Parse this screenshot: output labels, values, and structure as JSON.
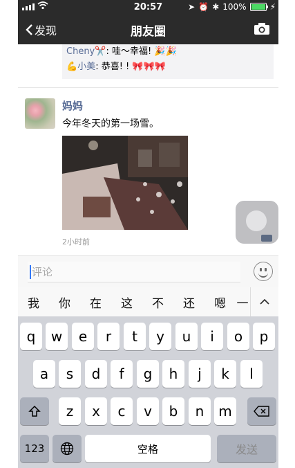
{
  "status": {
    "time": "20:57",
    "battery": "100%"
  },
  "nav": {
    "back_label": "发现",
    "title": "朋友圈"
  },
  "comments_top": [
    {
      "name": "Cheny",
      "emoji": "✂️",
      "text": ": 哇～幸福! ",
      "trail": "🎉🎉"
    },
    {
      "name": "小美",
      "emoji": "💪",
      "text": ": 恭喜! ! ",
      "trail": "🎀🎀🎀"
    }
  ],
  "post": {
    "author": "妈妈",
    "text": "今年冬天的第一场雪。",
    "time": "2小时前"
  },
  "input": {
    "placeholder": "评论"
  },
  "suggestions": [
    "我",
    "你",
    "在",
    "这",
    "不",
    "还",
    "嗯",
    "一"
  ],
  "keyboard": {
    "row1": [
      "q",
      "w",
      "e",
      "r",
      "t",
      "y",
      "u",
      "i",
      "o",
      "p"
    ],
    "row2": [
      "a",
      "s",
      "d",
      "f",
      "g",
      "h",
      "j",
      "k",
      "l"
    ],
    "row3": [
      "z",
      "x",
      "c",
      "v",
      "b",
      "n",
      "m"
    ],
    "numbers": "123",
    "space": "空格",
    "send": "发送"
  },
  "icons": {
    "back": "chevron-left-icon",
    "camera": "camera-icon",
    "emoji": "smiley-icon",
    "shift": "shift-icon",
    "delete": "backspace-icon",
    "globe": "globe-icon"
  }
}
